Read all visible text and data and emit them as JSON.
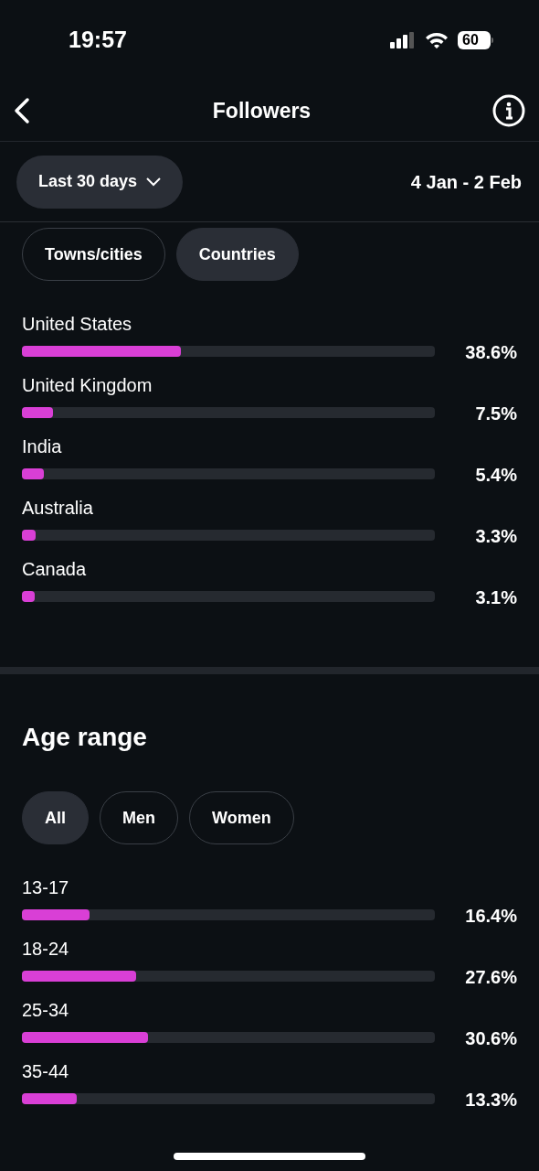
{
  "status_bar": {
    "time": "19:57",
    "battery": "60"
  },
  "nav": {
    "title": "Followers"
  },
  "period": {
    "label": "Last 30 days",
    "range": "4 Jan - 2 Feb"
  },
  "location_tabs": [
    {
      "label": "Towns/cities",
      "selected": false
    },
    {
      "label": "Countries",
      "selected": true
    }
  ],
  "countries": [
    {
      "name": "United States",
      "level": 0.386,
      "reading": "38.6%"
    },
    {
      "name": "United Kingdom",
      "level": 0.075,
      "reading": "7.5%"
    },
    {
      "name": "India",
      "level": 0.054,
      "reading": "5.4%"
    },
    {
      "name": "Australia",
      "level": 0.033,
      "reading": "3.3%"
    },
    {
      "name": "Canada",
      "level": 0.031,
      "reading": "3.1%"
    }
  ],
  "age_range": {
    "title": "Age range",
    "tabs": [
      {
        "label": "All",
        "selected": true
      },
      {
        "label": "Men",
        "selected": false
      },
      {
        "label": "Women",
        "selected": false
      }
    ],
    "rows": [
      {
        "name": "13-17",
        "level": 0.164,
        "reading": "16.4%"
      },
      {
        "name": "18-24",
        "level": 0.276,
        "reading": "27.6%"
      },
      {
        "name": "25-34",
        "level": 0.306,
        "reading": "30.6%"
      },
      {
        "name": "35-44",
        "level": 0.133,
        "reading": "13.3%"
      }
    ]
  }
}
